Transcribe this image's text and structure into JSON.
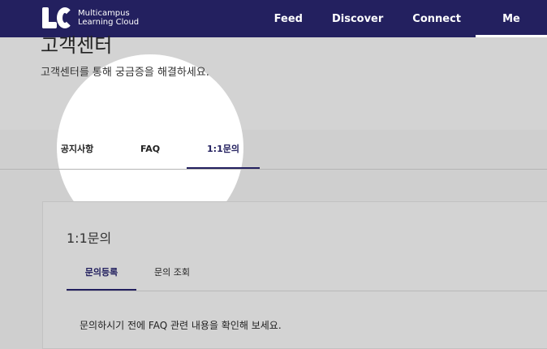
{
  "header": {
    "logo_line1": "Multicampus",
    "logo_line2": "Learning Cloud",
    "nav": [
      {
        "label": "Feed"
      },
      {
        "label": "Discover"
      },
      {
        "label": "Connect"
      },
      {
        "label": "Me"
      }
    ]
  },
  "page": {
    "title": "고객센터",
    "subtitle": "고객센터를 통해 궁금증을 해결하세요."
  },
  "tabs": [
    {
      "label": "공지사항"
    },
    {
      "label": "FAQ"
    },
    {
      "label": "1:1문의"
    }
  ],
  "panel": {
    "title": "1:1문의",
    "subtabs": [
      {
        "label": "문의등록"
      },
      {
        "label": "문의 조회"
      }
    ],
    "notice": "문의하시기 전에 FAQ 관련 내용을 확인해 보세요."
  },
  "colors": {
    "brand": "#23205f",
    "dim_overlay": "#cfcfcf",
    "spotlight": "#ffffff"
  }
}
